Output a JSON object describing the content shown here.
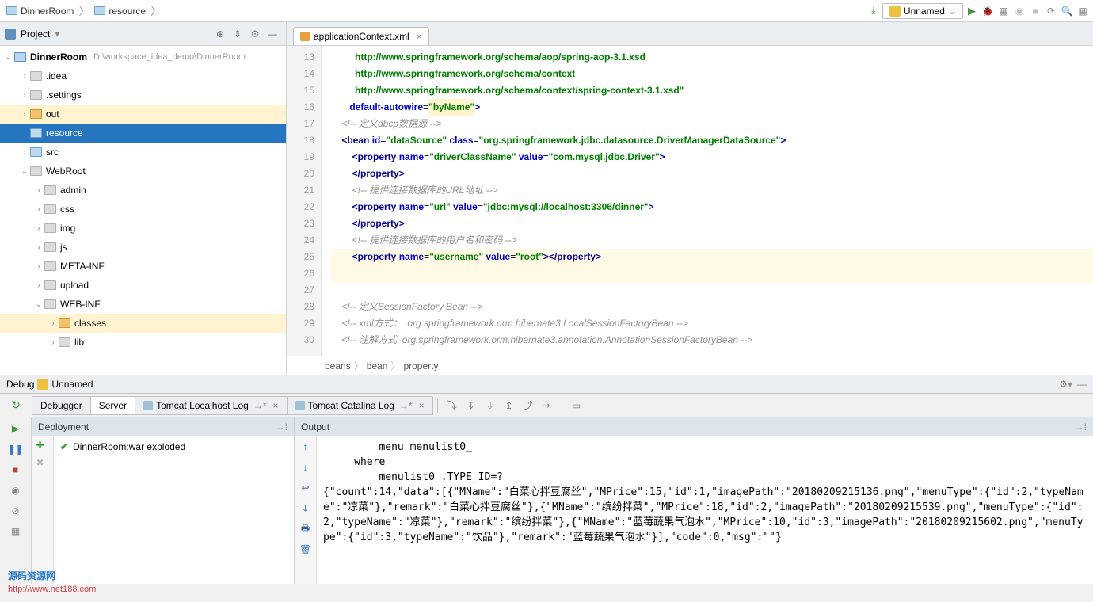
{
  "nav": {
    "crumb1": "DinnerRoom",
    "crumb2": "resource"
  },
  "toolbar": {
    "unnamed": "Unnamed"
  },
  "project_panel": {
    "title": "Project",
    "root_name": "DinnerRoom",
    "root_path": "D:\\workspace_idea_demo\\DinnerRoom",
    "items": [
      {
        "label": ".idea",
        "depth": 1,
        "arrow": "›",
        "color": "grey"
      },
      {
        "label": ".settings",
        "depth": 1,
        "arrow": "›",
        "color": "grey"
      },
      {
        "label": "out",
        "depth": 1,
        "arrow": "›",
        "color": "orange",
        "sel": "light"
      },
      {
        "label": "resource",
        "depth": 1,
        "arrow": "",
        "color": "blue",
        "sel": "yes"
      },
      {
        "label": "src",
        "depth": 1,
        "arrow": "›",
        "color": "blue"
      },
      {
        "label": "WebRoot",
        "depth": 1,
        "arrow": "⌄",
        "color": "grey"
      },
      {
        "label": "admin",
        "depth": 2,
        "arrow": "›",
        "color": "grey"
      },
      {
        "label": "css",
        "depth": 2,
        "arrow": "›",
        "color": "grey"
      },
      {
        "label": "img",
        "depth": 2,
        "arrow": "›",
        "color": "grey"
      },
      {
        "label": "js",
        "depth": 2,
        "arrow": "›",
        "color": "grey"
      },
      {
        "label": "META-INF",
        "depth": 2,
        "arrow": "›",
        "color": "grey"
      },
      {
        "label": "upload",
        "depth": 2,
        "arrow": "›",
        "color": "grey"
      },
      {
        "label": "WEB-INF",
        "depth": 2,
        "arrow": "⌄",
        "color": "grey"
      },
      {
        "label": "classes",
        "depth": 3,
        "arrow": "›",
        "color": "orange",
        "sel": "light"
      },
      {
        "label": "lib",
        "depth": 3,
        "arrow": "›",
        "color": "grey"
      }
    ]
  },
  "editor": {
    "tab_name": "applicationContext.xml",
    "line_start": 13,
    "lines": [
      {
        "n": 13,
        "html": "         <span class='t-str'>http://www.springframework.org/schema/aop/spring-aop-3.1.xsd</span>"
      },
      {
        "n": 14,
        "html": "         <span class='t-str'>http://www.springframework.org/schema/context</span>"
      },
      {
        "n": 15,
        "html": "         <span class='t-str'>http://www.springframework.org/schema/context/spring-context-3.1.xsd\"</span>"
      },
      {
        "n": 16,
        "html": "       <span class='t-attr'>default-autowire</span>=<span class='t-str hl-yellow'>\"byName\"</span><span class='t-tag'>&gt;</span>"
      },
      {
        "n": 17,
        "html": "    <span class='t-cmt'>&lt;!-- 定义dbcp数据源 --&gt;</span>"
      },
      {
        "n": 18,
        "html": "    <span class='t-tag'>&lt;bean</span> <span class='t-attr'>id</span>=<span class='t-str'>\"dataSource\"</span> <span class='t-attr'>class</span>=<span class='t-str'>\"org.springframework.jdbc.datasource.DriverManagerDataSource\"</span><span class='t-tag'>&gt;</span>"
      },
      {
        "n": 19,
        "html": "        <span class='t-tag'>&lt;property</span> <span class='t-attr'>name</span>=<span class='t-str'>\"driverClassName\"</span> <span class='t-attr'>value</span>=<span class='t-str'>\"com.mysql.jdbc.Driver\"</span><span class='t-tag'>&gt;</span>"
      },
      {
        "n": 20,
        "html": "        <span class='t-tag'>&lt;/property&gt;</span>"
      },
      {
        "n": 21,
        "html": "        <span class='t-cmt'>&lt;!-- 提供连接数据库的URL地址 --&gt;</span>"
      },
      {
        "n": 22,
        "html": "        <span class='t-tag'>&lt;property</span> <span class='t-attr'>name</span>=<span class='t-str'>\"url\"</span> <span class='t-attr'>value</span>=<span class='t-str'>\"jdbc:mysql://localhost:3306/dinner\"</span><span class='t-tag'>&gt;</span>"
      },
      {
        "n": 23,
        "html": "        <span class='t-tag'>&lt;/property&gt;</span>"
      },
      {
        "n": 24,
        "html": "        <span class='t-cmt'>&lt;!-- 提供连接数据库的用户名和密码 --&gt;</span>"
      },
      {
        "n": 25,
        "html": "<span class='caret-line' style='display:inline-block;width:100%'>        <span class='t-tag'>&lt;property</span> <span class='t-attr'>name</span>=<span class='t-str'>\"username\"</span> <span class='t-attr'>value</span>=<span class='t-str'>\"root\"</span><span class='t-tag'>&gt;&lt;/property&gt;</span></span>"
      },
      {
        "n": 26,
        "html": "<span class='caret-line' style='display:inline-block;width:100%'> </span>"
      },
      {
        "n": 27,
        "html": " "
      },
      {
        "n": 28,
        "html": "    <span class='t-cmt'>&lt;!-- 定义SessionFactory Bean --&gt;</span>"
      },
      {
        "n": 29,
        "html": "    <span class='t-cmt'>&lt;!-- xml方式：  org.springframework.orm.hibernate3.LocalSessionFactoryBean --&gt;</span>"
      },
      {
        "n": 30,
        "html": "    <span class='t-cmt'>&lt;!-- 注解方式  org.springframework.orm.hibernate3.annotation.AnnotationSessionFactoryBean --&gt;</span>"
      }
    ],
    "breadcrumb": {
      "a": "beans",
      "b": "bean",
      "c": "property"
    }
  },
  "debug": {
    "title": "Debug",
    "config": "Unnamed",
    "tabs": {
      "debugger": "Debugger",
      "server": "Server",
      "log1": "Tomcat Localhost Log",
      "log2": "Tomcat Catalina Log"
    },
    "deployment": {
      "title": "Deployment",
      "item": "DinnerRoom:war exploded"
    },
    "output": {
      "title": "Output",
      "text": "         menu menulist0_ \n     where\n         menulist0_.TYPE_ID=?\n{\"count\":14,\"data\":[{\"MName\":\"白菜心拌豆腐丝\",\"MPrice\":15,\"id\":1,\"imagePath\":\"20180209215136.png\",\"menuType\":{\"id\":2,\"typeName\":\"凉菜\"},\"remark\":\"白菜心拌豆腐丝\"},{\"MName\":\"缤纷拌菜\",\"MPrice\":18,\"id\":2,\"imagePath\":\"20180209215539.png\",\"menuType\":{\"id\":2,\"typeName\":\"凉菜\"},\"remark\":\"缤纷拌菜\"},{\"MName\":\"蓝莓蔬果气泡水\",\"MPrice\":10,\"id\":3,\"imagePath\":\"20180209215602.png\",\"menuType\":{\"id\":3,\"typeName\":\"饮品\"},\"remark\":\"蓝莓蔬果气泡水\"}],\"code\":0,\"msg\":\"\"}"
    }
  },
  "watermark": {
    "text": "源码资源网",
    "url": "http://www.net188.com"
  }
}
